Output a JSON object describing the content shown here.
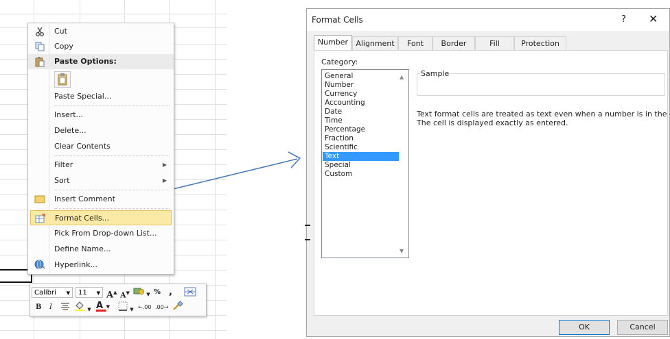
{
  "context_menu": {
    "items": [
      {
        "label": "Cut",
        "icon": "scissors-icon"
      },
      {
        "label": "Copy",
        "icon": "copy-icon"
      },
      {
        "label": "Paste Options:",
        "icon": "paste-icon"
      },
      {
        "label": "Paste Special..."
      },
      {
        "label": "Insert..."
      },
      {
        "label": "Delete..."
      },
      {
        "label": "Clear Contents"
      },
      {
        "label": "Filter",
        "submenu": true
      },
      {
        "label": "Sort",
        "submenu": true
      },
      {
        "label": "Insert Comment",
        "icon": "comment-icon"
      },
      {
        "label": "Format Cells...",
        "icon": "format-cells-icon",
        "highlighted": true
      },
      {
        "label": "Pick From Drop-down List..."
      },
      {
        "label": "Define Name..."
      },
      {
        "label": "Hyperlink...",
        "icon": "hyperlink-icon"
      }
    ]
  },
  "mini_toolbar": {
    "font_name": "Calibri",
    "font_size": "11",
    "percent": "%",
    "comma": ",",
    "bold": "B",
    "italic": "I",
    "grow_font": "A",
    "shrink_font": "A",
    "font_color": "A",
    "increase_decimal": ".00",
    "decrease_decimal": ".00",
    "font_color_hex": "#e0211b"
  },
  "dialog": {
    "title": "Format Cells",
    "help": "?",
    "close": "✕",
    "tabs": [
      "Number",
      "Alignment",
      "Font",
      "Border",
      "Fill",
      "Protection"
    ],
    "selected_tab": "Number",
    "category_label": "Category:",
    "categories": [
      "General",
      "Number",
      "Currency",
      "Accounting",
      "Date",
      "Time",
      "Percentage",
      "Fraction",
      "Scientific",
      "Text",
      "Special",
      "Custom"
    ],
    "selected_category": "Text",
    "sample_label": "Sample",
    "description_line1": "Text format cells are treated as text even when a number is in the cell.",
    "description_line2": "The cell is displayed exactly as entered.",
    "ok_label": "OK",
    "cancel_label": "Cancel",
    "selection_color": "#3399ff"
  }
}
